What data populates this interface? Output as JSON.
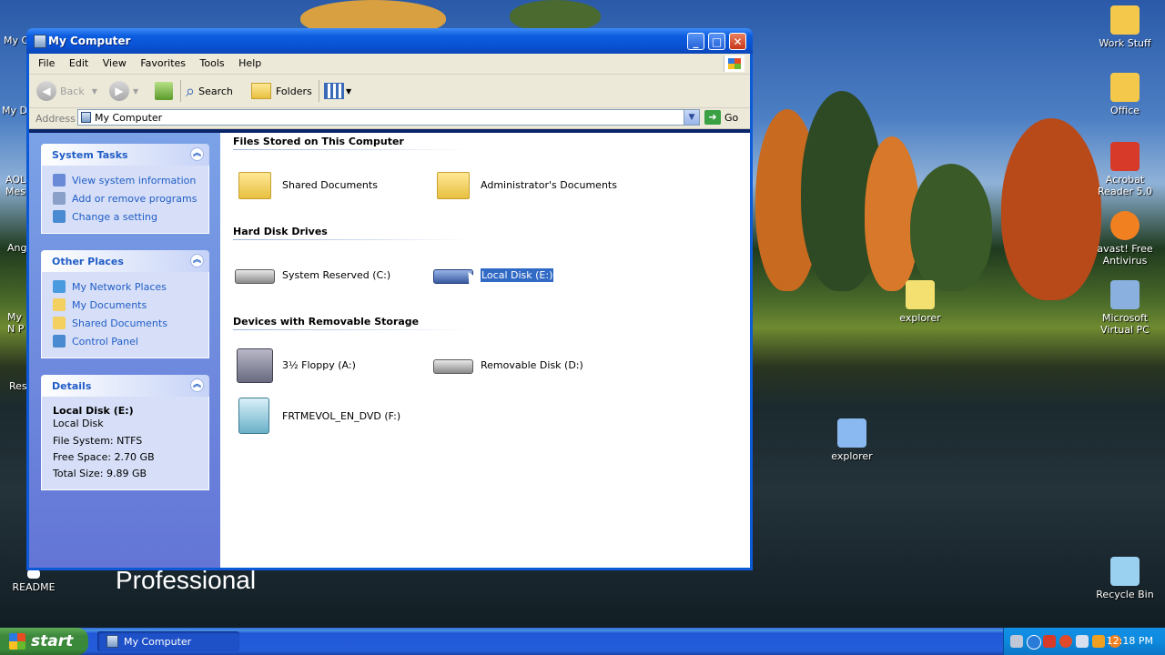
{
  "desktop": {
    "icons_right": [
      {
        "label": "Work Stuff",
        "color": "#f4c84a"
      },
      {
        "label": "Office",
        "color": "#f4c84a"
      },
      {
        "label": "Acrobat Reader 5.0",
        "color": "#d83a2a"
      },
      {
        "label": "avast! Free Antivirus",
        "color": "#f08020"
      },
      {
        "label": "Microsoft Virtual PC",
        "color": "#8ab0e0"
      },
      {
        "label": "Recycle Bin",
        "color": "#9ad0f0"
      }
    ],
    "icons_middle": [
      {
        "label": "explorer",
        "color": "#f4e070"
      },
      {
        "label": "explorer",
        "color": "#8ab8f0"
      }
    ],
    "left_edge_labels": [
      "My C",
      "My Do",
      "AOL Mes",
      "Ang",
      "My N P",
      "Res",
      "README"
    ],
    "watermark_text": "Professional"
  },
  "window": {
    "title": "My Computer",
    "controls": {
      "minimize": "_",
      "maximize": "□",
      "close": "✕"
    }
  },
  "menu": [
    "File",
    "Edit",
    "View",
    "Favorites",
    "Tools",
    "Help"
  ],
  "toolbar": {
    "back": "Back",
    "search": "Search",
    "folders": "Folders"
  },
  "address": {
    "label": "Address",
    "value": "My Computer",
    "go": "Go"
  },
  "task_pane": {
    "system_tasks": {
      "title": "System Tasks",
      "links": [
        {
          "label": "View system information",
          "icon": "info-icon",
          "color": "#6a8ad8"
        },
        {
          "label": "Add or remove programs",
          "icon": "programs-icon",
          "color": "#8aa0c8"
        },
        {
          "label": "Change a setting",
          "icon": "control-panel-icon",
          "color": "#4a8ad0"
        }
      ]
    },
    "other_places": {
      "title": "Other Places",
      "links": [
        {
          "label": "My Network Places",
          "icon": "network-icon",
          "color": "#4a9ae0"
        },
        {
          "label": "My Documents",
          "icon": "folder-icon",
          "color": "#f4d060"
        },
        {
          "label": "Shared Documents",
          "icon": "folder-icon",
          "color": "#f4d060"
        },
        {
          "label": "Control Panel",
          "icon": "control-panel-icon",
          "color": "#4a8ad0"
        }
      ]
    },
    "details": {
      "title": "Details",
      "name": "Local Disk (E:)",
      "type": "Local Disk",
      "file_system": "File System: NTFS",
      "free_space": "Free Space: 2.70 GB",
      "total_size": "Total Size: 9.89 GB"
    }
  },
  "content": {
    "groups": [
      {
        "title": "Files Stored on This Computer",
        "items": [
          "Shared Documents",
          "Administrator's Documents"
        ]
      },
      {
        "title": "Hard Disk Drives",
        "items": [
          "System Reserved (C:)",
          "Local Disk (E:)"
        ]
      },
      {
        "title": "Devices with Removable Storage",
        "items": [
          "3½ Floppy (A:)",
          "Removable Disk (D:)",
          "FRTMEVOL_EN_DVD (F:)"
        ]
      }
    ],
    "selected_item": "Local Disk (E:)"
  },
  "taskbar": {
    "start_label": "start",
    "task_button": "My Computer",
    "clock": "12:18 PM",
    "tray_icons": [
      {
        "name": "pen-icon",
        "color": "#c0c8d8"
      },
      {
        "name": "network-icon",
        "color": "#2a7ad8"
      },
      {
        "name": "shield-icon",
        "color": "#d83a2a"
      },
      {
        "name": "security-alert-icon",
        "color": "#e04a2a"
      },
      {
        "name": "wireless-icon",
        "color": "#d8e0f0"
      },
      {
        "name": "running-man-icon",
        "color": "#f0a020"
      },
      {
        "name": "avast-icon",
        "color": "#f08020"
      }
    ]
  }
}
